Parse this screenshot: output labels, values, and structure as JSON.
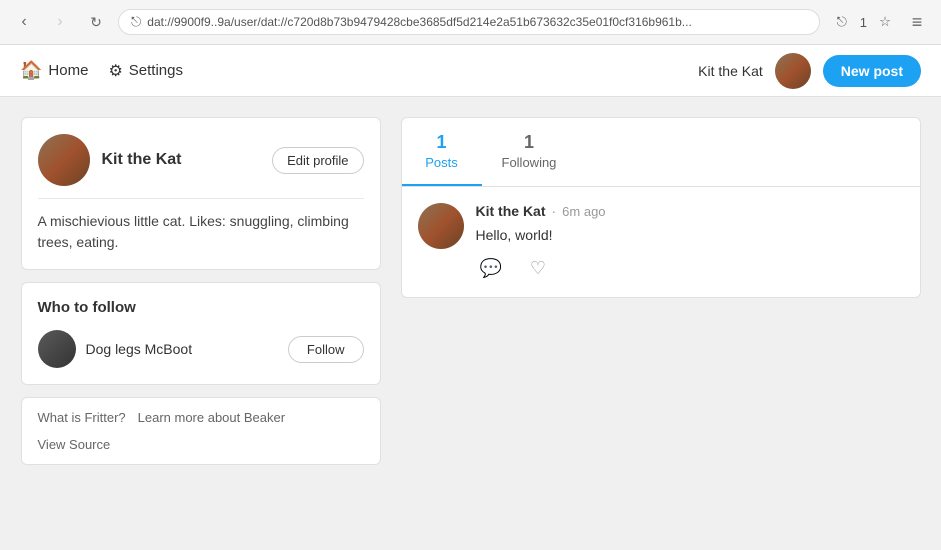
{
  "browser": {
    "url": "dat://9900f9..9a/user/dat://c720d8b73b9479428cbe3685df5d214e2a51b673632c35e01f0cf316b961b...",
    "share_count": "1",
    "back_disabled": false,
    "forward_disabled": false
  },
  "nav": {
    "home_label": "Home",
    "settings_label": "Settings",
    "username": "Kit the Kat",
    "new_post_label": "New post"
  },
  "profile": {
    "name": "Kit the Kat",
    "bio": "A mischievious little cat. Likes: snuggling, climbing trees, eating.",
    "edit_button_label": "Edit profile"
  },
  "who_to_follow": {
    "title": "Who to follow",
    "users": [
      {
        "name": "Dog legs McBoot",
        "follow_label": "Follow"
      }
    ]
  },
  "footer": {
    "links": [
      {
        "label": "What is Fritter?"
      },
      {
        "label": "Learn more about Beaker"
      },
      {
        "label": "View Source"
      }
    ]
  },
  "tabs": [
    {
      "label": "Posts",
      "count": "1",
      "active": true
    },
    {
      "label": "Following",
      "count": "1",
      "active": false
    }
  ],
  "posts": [
    {
      "username": "Kit the Kat",
      "time": "6m ago",
      "text": "Hello, world!",
      "dot": "·"
    }
  ],
  "icons": {
    "back": "‹",
    "forward": "›",
    "refresh": "↻",
    "share": "⎋",
    "home": "⌂",
    "settings": "⚙",
    "menu": "≡",
    "star": "☆",
    "comment": "💬",
    "heart": "♡"
  }
}
